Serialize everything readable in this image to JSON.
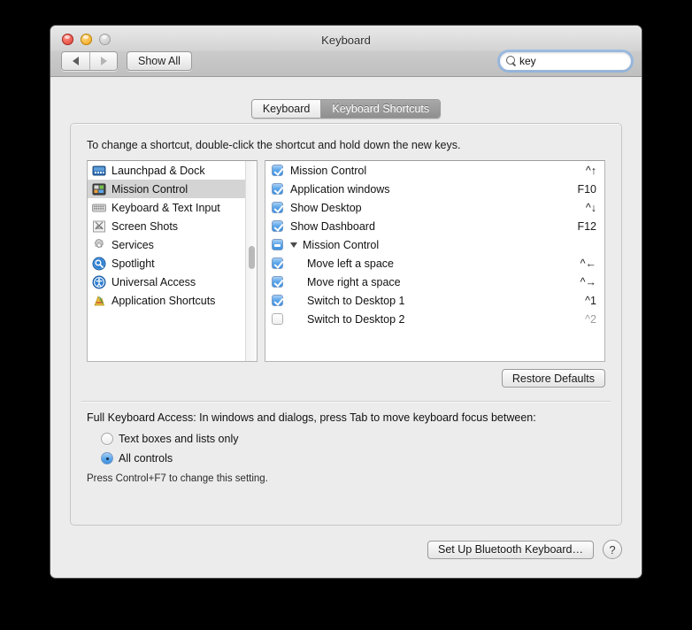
{
  "window": {
    "title": "Keyboard",
    "traffic_lights": [
      "close",
      "minimize",
      "zoom"
    ]
  },
  "toolbar": {
    "back_label": "Back",
    "forward_label": "Forward",
    "show_all_label": "Show All",
    "search": {
      "value": "key",
      "placeholder": "Search",
      "icon": "search-icon",
      "clear_icon": "clear-icon"
    }
  },
  "tabs": [
    {
      "label": "Keyboard",
      "active": false
    },
    {
      "label": "Keyboard Shortcuts",
      "active": true
    }
  ],
  "main": {
    "hint": "To change a shortcut, double-click the shortcut and hold down the new keys.",
    "categories": [
      {
        "label": "Launchpad & Dock",
        "icon": "launchpad-dock-icon",
        "selected": false
      },
      {
        "label": "Mission Control",
        "icon": "mission-control-icon",
        "selected": true
      },
      {
        "label": "Keyboard & Text Input",
        "icon": "keyboard-text-input-icon",
        "selected": false
      },
      {
        "label": "Screen Shots",
        "icon": "screen-shots-icon",
        "selected": false
      },
      {
        "label": "Services",
        "icon": "services-gear-icon",
        "selected": false
      },
      {
        "label": "Spotlight",
        "icon": "spotlight-icon",
        "selected": false
      },
      {
        "label": "Universal Access",
        "icon": "universal-access-icon",
        "selected": false
      },
      {
        "label": "Application Shortcuts",
        "icon": "application-shortcuts-icon",
        "selected": false
      }
    ],
    "shortcuts": [
      {
        "label": "Mission Control",
        "key": "^↑",
        "checked": "on",
        "level": "top",
        "disclosure": false
      },
      {
        "label": "Application windows",
        "key": "F10",
        "checked": "on",
        "level": "top",
        "disclosure": false
      },
      {
        "label": "Show Desktop",
        "key": "^↓",
        "checked": "on",
        "level": "top",
        "disclosure": false
      },
      {
        "label": "Show Dashboard",
        "key": "F12",
        "checked": "on",
        "level": "top",
        "disclosure": false
      },
      {
        "label": "Mission Control",
        "key": "",
        "checked": "mixed",
        "level": "group",
        "disclosure": true
      },
      {
        "label": "Move left a space",
        "key": "^←",
        "checked": "on",
        "level": "child",
        "disclosure": false
      },
      {
        "label": "Move right a space",
        "key": "^→",
        "checked": "on",
        "level": "child",
        "disclosure": false
      },
      {
        "label": "Switch to Desktop 1",
        "key": "^1",
        "checked": "on",
        "level": "child",
        "disclosure": false
      },
      {
        "label": "Switch to Desktop 2",
        "key": "^2",
        "checked": "off",
        "level": "child",
        "disclosure": false
      }
    ],
    "restore_defaults_label": "Restore Defaults",
    "full_keyboard_access": {
      "title": "Full Keyboard Access: In windows and dialogs, press Tab to move keyboard focus between:",
      "options": [
        {
          "label": "Text boxes and lists only",
          "selected": false
        },
        {
          "label": "All controls",
          "selected": true
        }
      ],
      "note": "Press Control+F7 to change this setting."
    }
  },
  "footer": {
    "bluetooth_label": "Set Up Bluetooth Keyboard…",
    "help_label": "?"
  },
  "colors": {
    "accent_blue": "#3e90e0",
    "selected_row": "#d4d4d4",
    "window_bg": "#ececec",
    "tab_active": "#9b9b9b"
  }
}
